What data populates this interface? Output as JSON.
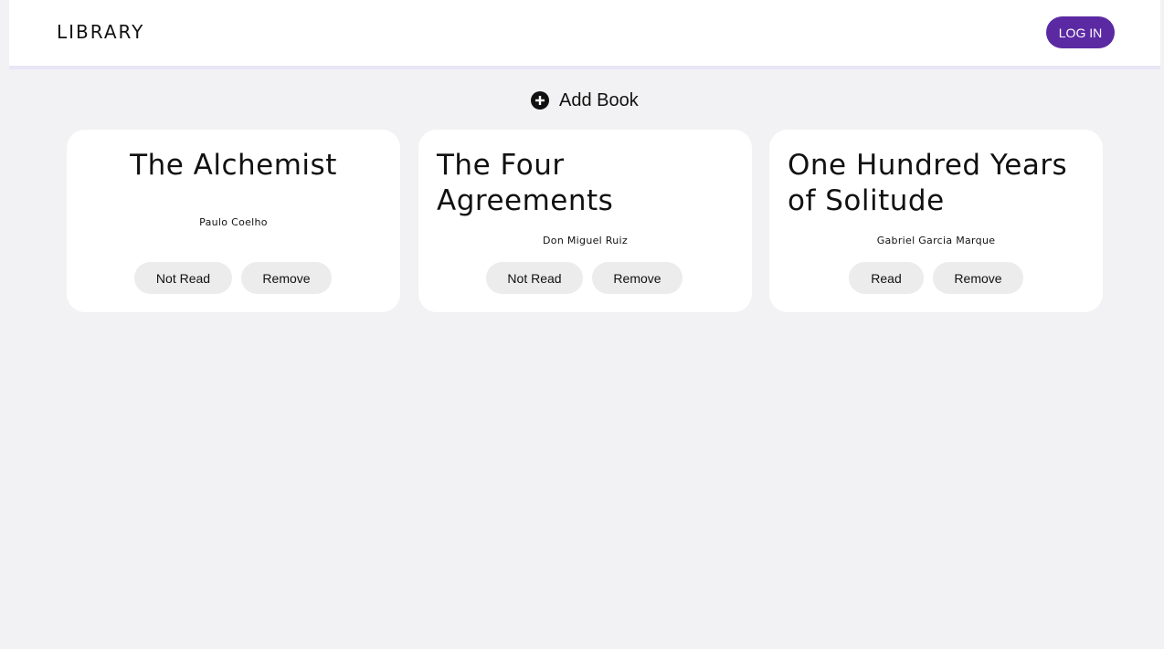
{
  "header": {
    "logo": "LIBRARY",
    "login_label": "LOG IN",
    "accent_color": "#5b2aa3"
  },
  "toolbar": {
    "add_book_label": "Add Book",
    "add_icon": "plus-circle-icon"
  },
  "books": [
    {
      "title": "The Alchemist",
      "author": "Paulo Coelho",
      "status_label": "Not Read",
      "remove_label": "Remove"
    },
    {
      "title": "The Four Agreements",
      "author": "Don Miguel Ruiz",
      "status_label": "Not Read",
      "remove_label": "Remove"
    },
    {
      "title": "One Hundred Years of Solitude",
      "author": "Gabriel Garcia Marque",
      "status_label": "Read",
      "remove_label": "Remove"
    }
  ]
}
